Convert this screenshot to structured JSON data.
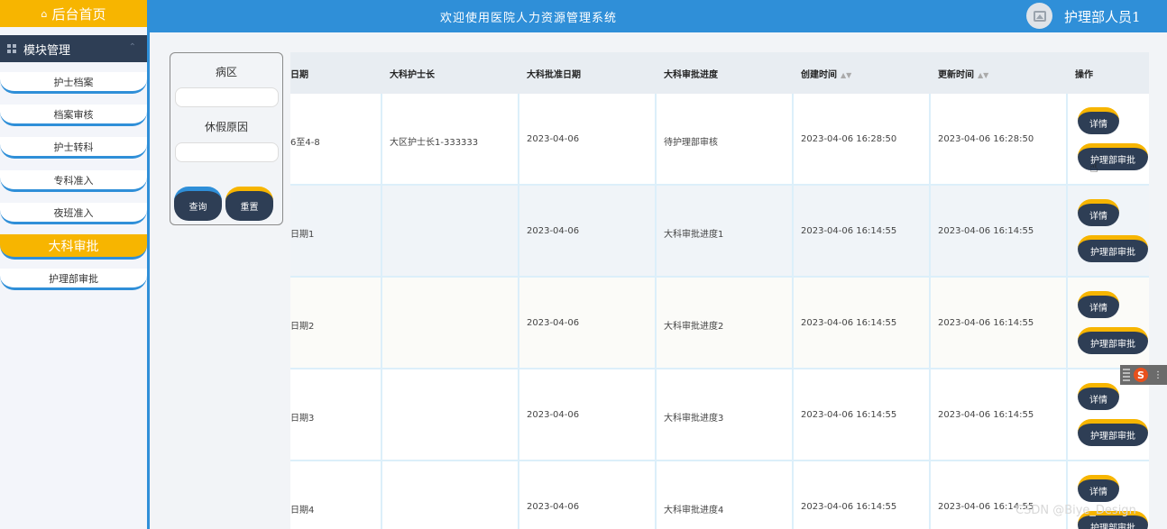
{
  "sidebar": {
    "home_label": "后台首页",
    "module_label": "模块管理",
    "items": [
      {
        "label": "护士档案"
      },
      {
        "label": "档案审核"
      },
      {
        "label": "护士转科"
      },
      {
        "label": "专科准入"
      },
      {
        "label": "夜班准入"
      },
      {
        "label": "大科审批",
        "active": true
      },
      {
        "label": "护理部审批"
      }
    ]
  },
  "header": {
    "title": "欢迎使用医院人力资源管理系统",
    "user": "护理部人员1"
  },
  "search": {
    "field1_label": "病区",
    "field2_label": "休假原因",
    "query_button": "查询",
    "reset_button": "重置"
  },
  "table": {
    "columns": [
      "日期",
      "大科护士长",
      "大科批准日期",
      "大科审批进度",
      "创建时间",
      "更新时间",
      "操作"
    ],
    "rows": [
      {
        "date": "6至4-8",
        "head_nurse": "大区护士长1-333333",
        "approve_date": "2023-04-06",
        "progress": "待护理部审核",
        "created": "2023-04-06 16:28:50",
        "updated": "2023-04-06 16:28:50"
      },
      {
        "date": "日期1",
        "head_nurse": "",
        "approve_date": "2023-04-06",
        "progress": "大科审批进度1",
        "created": "2023-04-06 16:14:55",
        "updated": "2023-04-06 16:14:55"
      },
      {
        "date": "日期2",
        "head_nurse": "",
        "approve_date": "2023-04-06",
        "progress": "大科审批进度2",
        "created": "2023-04-06 16:14:55",
        "updated": "2023-04-06 16:14:55"
      },
      {
        "date": "日期3",
        "head_nurse": "",
        "approve_date": "2023-04-06",
        "progress": "大科审批进度3",
        "created": "2023-04-06 16:14:55",
        "updated": "2023-04-06 16:14:55"
      },
      {
        "date": "日期4",
        "head_nurse": "",
        "approve_date": "2023-04-06",
        "progress": "大科审批进度4",
        "created": "2023-04-06 16:14:55",
        "updated": "2023-04-06 16:14:55"
      }
    ],
    "detail_button": "详情",
    "approve_button": "护理部审批"
  },
  "ime": {
    "logo": "S"
  },
  "watermark": "CSDN @Biye_Design",
  "colors": {
    "primary": "#2f8fd8",
    "accent": "#f7b500",
    "dark": "#2e3e55"
  }
}
